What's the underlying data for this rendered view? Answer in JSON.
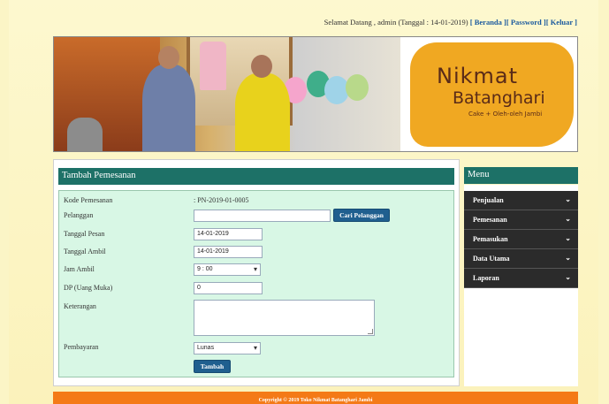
{
  "header": {
    "welcome": "Selamat Datang , admin (Tanggal : 14-01-2019)",
    "links": [
      "[ Beranda ]",
      "[ Password ]",
      "[ Keluar ]"
    ]
  },
  "logo": {
    "line1": "Nikmat",
    "line2": "Batanghari",
    "tagline": "Cake + Oleh-oleh Jambi"
  },
  "form": {
    "title": "Tambah Pemesanan",
    "fields": {
      "kode": {
        "label": "Kode Pemesanan",
        "value": ": PN-2019-01-0005"
      },
      "pelanggan": {
        "label": "Pelanggan",
        "value": ""
      },
      "tanggal_pesan": {
        "label": "Tanggal Pesan",
        "value": "14-01-2019"
      },
      "tanggal_ambil": {
        "label": "Tanggal Ambil",
        "value": "14-01-2019"
      },
      "jam_ambil": {
        "label": "Jam Ambil",
        "value": "9 : 00"
      },
      "dp": {
        "label": "DP (Uang Muka)",
        "value": "0"
      },
      "keterangan": {
        "label": "Keterangan",
        "value": ""
      },
      "pembayaran": {
        "label": "Pembayaran",
        "value": "Lunas"
      }
    },
    "cari_button": "Cari Pelanggan",
    "submit_button": "Tambah"
  },
  "sidebar": {
    "title": "Menu",
    "items": [
      "Penjualan",
      "Pemesanan",
      "Pemasukan",
      "Data Utama",
      "Laporan"
    ]
  },
  "footer": {
    "text": "Copyright © 2019 Toko Nikmat Batanghari Jambi"
  },
  "colors": {
    "header_bar": "#1d7167",
    "form_bg": "#d8f7e5",
    "menu_bg": "#2b2b2b",
    "footer": "#f47a17",
    "button": "#1f5f8f"
  }
}
